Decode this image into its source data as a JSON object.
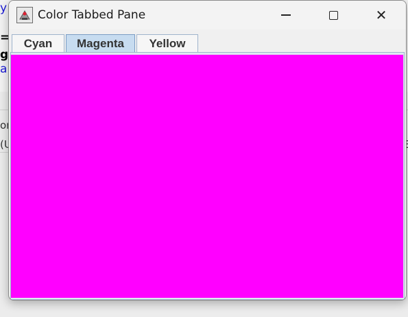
{
  "window": {
    "title": "Color Tabbed Pane",
    "controls": {
      "minimize_icon": "minimize-icon",
      "maximize_icon": "maximize-icon",
      "close_icon": "close-icon",
      "close_glyph": "✕"
    }
  },
  "tabs": [
    {
      "label": "Cyan",
      "color": "#00ffff",
      "selected": false
    },
    {
      "label": "Magenta",
      "color": "#ff00ff",
      "selected": true
    },
    {
      "label": "Yellow",
      "color": "#ffff00",
      "selected": false
    }
  ],
  "content": {
    "active_color": "#ff00ff"
  },
  "background": {
    "fragments": [
      "y",
      "=",
      "g",
      "a",
      "or",
      "(U",
      "E"
    ]
  }
}
